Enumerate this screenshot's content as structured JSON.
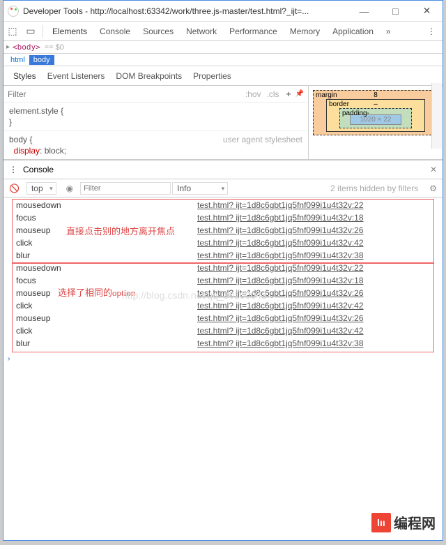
{
  "window": {
    "title": "Developer Tools - http://localhost:63342/work/three.js-master/test.html?_ijt=..."
  },
  "tabs": {
    "t0": "Elements",
    "t1": "Console",
    "t2": "Sources",
    "t3": "Network",
    "t4": "Performance",
    "t5": "Memory",
    "t6": "Application",
    "more": "»"
  },
  "crumbs": {
    "html": "html",
    "body": "body",
    "meta": "== $0",
    "bodyTag": "<body>"
  },
  "subtabs": {
    "s0": "Styles",
    "s1": "Event Listeners",
    "s2": "DOM Breakpoints",
    "s3": "Properties"
  },
  "styles": {
    "filter": "Filter",
    "hov": ":hov",
    "cls": ".cls",
    "plus": "+",
    "elstyle": "element.style {",
    "close": "}",
    "body": "body {",
    "uas": "user agent stylesheet",
    "display": "display",
    "block": " block;"
  },
  "box": {
    "margin": "margin",
    "mnum": "8",
    "border": "border",
    "bnum": "–",
    "padding": "padding-",
    "content": "1020 × 22"
  },
  "console": {
    "title": "Console",
    "top": "top",
    "filter": "Filter",
    "info": "Info",
    "hidden": "2 items hidden by filters"
  },
  "logs": {
    "events": [
      "mousedown",
      "focus",
      "mouseup",
      "click",
      "blur",
      "mousedown",
      "focus",
      "mouseup",
      "click",
      "mouseup",
      "click",
      "blur"
    ],
    "lines": [
      "22",
      "18",
      "26",
      "42",
      "38",
      "22",
      "18",
      "26",
      "42",
      "26",
      "42",
      "38"
    ],
    "srcBase": "test.html? ijt=1d8c6gbt1jq5fnf099i1u4t32v:"
  },
  "annot": {
    "a1": "直接点击别的地方离开焦点",
    "a2": "选择了相同的option"
  },
  "wm": {
    "text": "http://blog.csdn.net/qq_30100043"
  },
  "logo": {
    "badge": "lıı",
    "text": "编程网"
  }
}
